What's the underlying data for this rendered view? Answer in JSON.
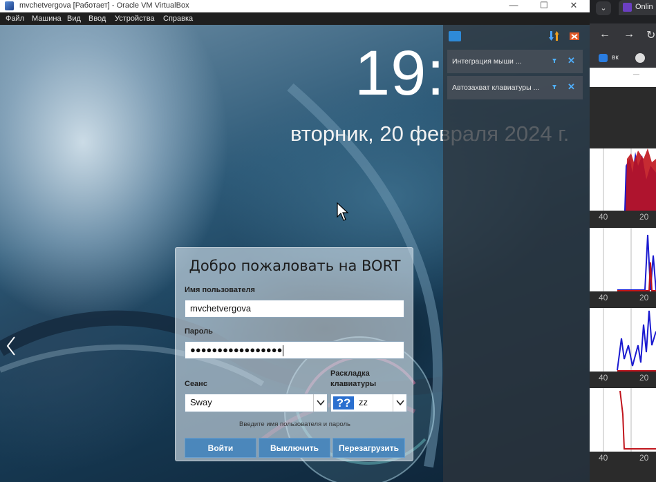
{
  "window": {
    "title": "mvchetvergova [Работает] - Oracle VM VirtualBox",
    "controls": {
      "minimize": "—",
      "maximize": "☐",
      "close": "✕"
    }
  },
  "menubar": [
    "Файл",
    "Машина",
    "Вид",
    "Ввод",
    "Устройства",
    "Справка"
  ],
  "lockscreen": {
    "time": "19:",
    "date": "вторник, 20 февраля 2024 г."
  },
  "notifications": [
    {
      "text": "Интеграция мыши ..."
    },
    {
      "text": "Автозахват клавиатуры ..."
    }
  ],
  "login": {
    "welcome": "Добро пожаловать на BORT",
    "username_label": "Имя пользователя",
    "username_value": "mvchetvergova",
    "password_label": "Пароль",
    "password_mask": "●●●●●●●●●●●●●●●●●",
    "session_label": "Сеанс",
    "session_value": "Sway",
    "layout_label_1": "Раскладка",
    "layout_label_2": "клавиатуры",
    "layout_flag": "??",
    "layout_value": "zz",
    "hint": "Введите имя пользователя и пароль",
    "buttons": {
      "login": "Войти",
      "shutdown": "Выключить",
      "reboot": "Перезагрузить"
    }
  },
  "browser": {
    "tab_title": "Onlin",
    "tab_dropdown": "⌄",
    "bookmark": "вк",
    "page_dash": "—",
    "graph_axis_labels": [
      {
        "left": "40",
        "right": "20"
      },
      {
        "left": "40",
        "right": "20"
      },
      {
        "left": "40",
        "right": "20"
      },
      {
        "left": "40",
        "right": "20"
      }
    ]
  },
  "colors": {
    "accent_button": "#4b87bb",
    "notification_close": "#4fb0ff",
    "graph_red": "#c0141c",
    "graph_blue": "#1a1ad0"
  }
}
